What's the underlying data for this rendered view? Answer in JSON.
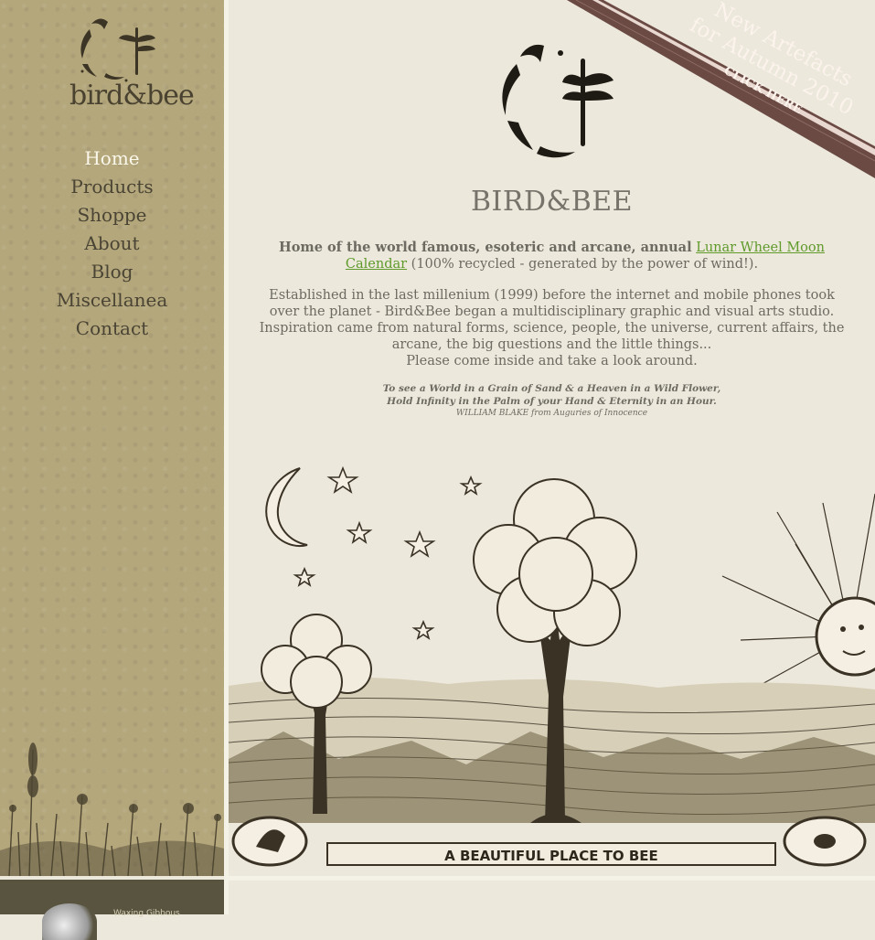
{
  "sidebar": {
    "logo_text": "bird&bee",
    "nav": [
      {
        "label": "Home",
        "active": true
      },
      {
        "label": "Products",
        "active": false
      },
      {
        "label": "Shoppe",
        "active": false
      },
      {
        "label": "About",
        "active": false
      },
      {
        "label": "Blog",
        "active": false
      },
      {
        "label": "Miscellanea",
        "active": false
      },
      {
        "label": "Contact",
        "active": false
      }
    ],
    "moon_phase_label": "Waxing Gibbous"
  },
  "banner": {
    "line1": "New Artefacts",
    "line2": "for Autumn 2010",
    "cta": "CLICK HERE"
  },
  "main": {
    "title": "BIRD&BEE",
    "intro_lead": "Home of the world famous, esoteric and arcane, annual",
    "intro_link": "Lunar Wheel Moon Calendar",
    "intro_tail": "(100% recycled - generated by the power of wind!).",
    "about_text": "Established in the last millenium (1999) before the internet and mobile phones took over the planet - Bird&Bee began a multidisciplinary graphic and visual arts studio. Inspiration came from natural forms, science, people, the universe, current affairs, the arcane, the big questions and the little things...",
    "about_invite": "Please come inside and take a look around.",
    "quote_line1": "To see a World in a Grain of Sand & a Heaven in a Wild Flower,",
    "quote_line2": "Hold Infinity in the Palm of your Hand & Eternity in an Hour.",
    "quote_attribution": "WILLIAM BLAKE from Auguries of Innocence",
    "illustration_banner": "A BEAUTIFUL PLACE TO BEE"
  },
  "colors": {
    "sidebar_bg": "#b4a77c",
    "page_bg": "#ece8dc",
    "banner_bg": "#6b4a44",
    "link": "#5f9a2b",
    "active_nav": "#fbf7ea"
  }
}
